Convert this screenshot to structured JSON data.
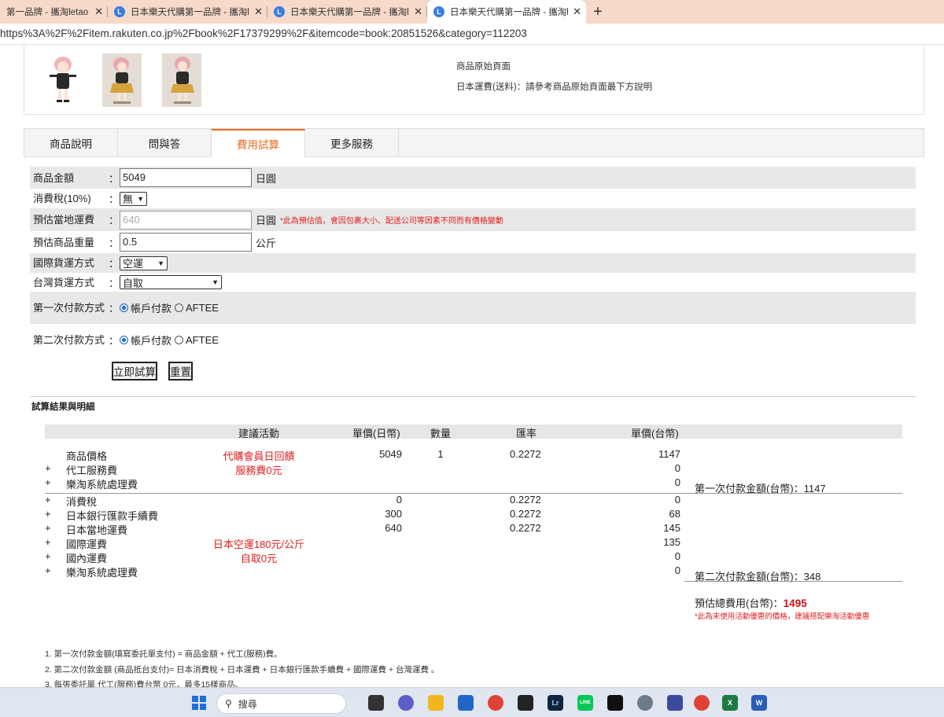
{
  "browser": {
    "tabs": [
      {
        "title": "第一品牌 - 攜淘letao -",
        "icon": "tab-favicon",
        "active": false
      },
      {
        "title": "日本樂天代購第一品牌 - 攜淘letao",
        "icon": "tab-favicon",
        "active": false
      },
      {
        "title": "日本樂天代購第一品牌 - 攜淘letao",
        "icon": "tab-favicon",
        "active": false
      },
      {
        "title": "日本樂天代購第一品牌 - 攜淘letao",
        "icon": "tab-favicon",
        "active": true
      }
    ],
    "close_glyph": "✕",
    "new_tab_glyph": "+",
    "url": "https%3A%2F%2Fitem.rakuten.co.jp%2Fbook%2F17379299%2F&itemcode=book:20851526&category=112203"
  },
  "product": {
    "info_lines": [
      "商品原始頁面",
      "日本運費(送料)：請參考商品原始頁面最下方說明"
    ]
  },
  "tabs": [
    "商品說明",
    "問與答",
    "費用試算",
    "更多服務"
  ],
  "active_tab": "費用試算",
  "form": {
    "colon": "：",
    "price_label": "商品金額",
    "price_value": "5049",
    "price_unit": "日圓",
    "tax_label": "消費稅(10%)",
    "tax_value": "無",
    "local_ship_label": "預估當地運費",
    "local_ship_value": "640",
    "local_ship_unit": "日圓",
    "local_ship_note": "*此為預估值，會因包裹大小、配送公司等因素不同而有價格變動",
    "weight_label": "預估商品重量",
    "weight_value": "0.5",
    "weight_unit": "公斤",
    "intl_method_label": "國際貨運方式",
    "intl_method_value": "空運",
    "tw_method_label": "台灣貨運方式",
    "tw_method_value": "自取",
    "pay1_label": "第一次付款方式",
    "pay2_label": "第二次付款方式",
    "pay_opt_account": "帳戶付款",
    "pay_opt_aftee": "AFTEE",
    "calc_button": "立即試算",
    "reset_button": "重置"
  },
  "results": {
    "section_title": "試算結果與明細",
    "headers": {
      "activity": "建議活動",
      "unit_jpy": "單價(日幣)",
      "qty": "數量",
      "rate": "匯率",
      "unit_twd": "單價(台幣)"
    },
    "rows": [
      {
        "prefix": "",
        "name": "商品價格",
        "activity": "代購會員日回饋",
        "jpy": "5049",
        "qty": "1",
        "rate": "0.2272",
        "twd": "1147"
      },
      {
        "prefix": "+",
        "name": "代工服務費",
        "activity": "服務費0元",
        "jpy": "",
        "qty": "",
        "rate": "",
        "twd": "0"
      },
      {
        "prefix": "+",
        "name": "樂淘系統處理費",
        "activity": "",
        "jpy": "",
        "qty": "",
        "rate": "",
        "twd": "0"
      },
      {
        "prefix": "+",
        "name": "消費稅",
        "activity": "",
        "jpy": "0",
        "qty": "",
        "rate": "0.2272",
        "twd": "0"
      },
      {
        "prefix": "+",
        "name": "日本銀行匯款手續費",
        "activity": "",
        "jpy": "300",
        "qty": "",
        "rate": "0.2272",
        "twd": "68"
      },
      {
        "prefix": "+",
        "name": "日本當地運費",
        "activity": "",
        "jpy": "640",
        "qty": "",
        "rate": "0.2272",
        "twd": "145"
      },
      {
        "prefix": "+",
        "name": "國際運費",
        "activity": "日本空運180元/公斤",
        "jpy": "",
        "qty": "",
        "rate": "",
        "twd": "135"
      },
      {
        "prefix": "+",
        "name": "國內運費",
        "activity": "自取0元",
        "jpy": "",
        "qty": "",
        "rate": "",
        "twd": "0"
      },
      {
        "prefix": "+",
        "name": "樂淘系統處理費",
        "activity": "",
        "jpy": "",
        "qty": "",
        "rate": "",
        "twd": "0"
      }
    ],
    "first_payment": "第一次付款金額(台幣)：1147",
    "second_payment": "第二次付款金額(台幣)：348",
    "total_label": "預估總費用(台幣)：",
    "total_value": "1495",
    "total_note": "*此為未使用活動優惠的價格，建議搭配樂淘活動優惠"
  },
  "footnotes": [
    "1. 第一次付款金額(填寫委託單支付) = 商品金額 + 代工(服務)費。",
    "2. 第二次付款金額 (商品抵台支付)= 日本消費稅 + 日本運費 + 日本銀行匯款手續費 + 國際運費 + 台灣運費 。",
    "3. 每張委託單 代工(服務)費台幣 0元，最多15樣商品。"
  ],
  "taskbar": {
    "search_placeholder": "搜尋",
    "apps": [
      "file-explorer-icon",
      "meet-icon",
      "folder-icon",
      "store-icon",
      "chrome-icon",
      "capture-icon",
      "lightroom-icon",
      "line-icon",
      "capcut-icon",
      "settings-icon",
      "app-icon",
      "chrome-profile-icon",
      "excel-icon",
      "word-icon"
    ],
    "app_labels": {
      "lightroom": "Lr",
      "line": "LINE",
      "excel": "X",
      "word": "W"
    }
  },
  "colors": {
    "accent": "#e86a20",
    "warning_red": "#e02020",
    "tab_strip": "#f6d9c8"
  }
}
